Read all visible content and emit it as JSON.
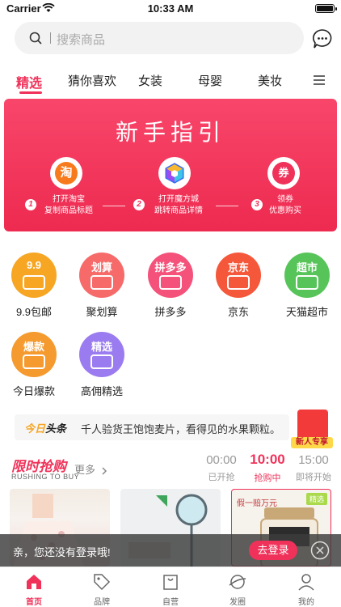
{
  "status_bar": {
    "carrier": "Carrier",
    "time": "10:33 AM"
  },
  "search": {
    "placeholder": "搜索商品"
  },
  "tabs": [
    {
      "label": "精选",
      "active": true
    },
    {
      "label": "猜你喜欢",
      "active": false
    },
    {
      "label": "女装",
      "active": false
    },
    {
      "label": "母婴",
      "active": false
    },
    {
      "label": "美妆",
      "active": false
    }
  ],
  "banner": {
    "title": "新手指引",
    "steps": [
      {
        "num": "1",
        "icon": "taobao-icon",
        "glyph": "淘",
        "line1": "打开淘宝",
        "line2": "复制商品标题"
      },
      {
        "num": "2",
        "icon": "cube-icon",
        "glyph": "",
        "line1": "打开魔方城",
        "line2": "跳转商品详情"
      },
      {
        "num": "3",
        "icon": "coupon-icon",
        "glyph": "券",
        "line1": "领券",
        "line2": "优惠购买"
      }
    ]
  },
  "grid": [
    {
      "label": "9.9包邮",
      "glyph": "9.9",
      "color": "#f6a623",
      "icon": "calendar-icon"
    },
    {
      "label": "聚划算",
      "glyph": "划算",
      "color": "#f66a6a",
      "icon": "shopping-bag-icon"
    },
    {
      "label": "拼多多",
      "glyph": "拼多多",
      "color": "#f4527a",
      "icon": "pinduoduo-icon"
    },
    {
      "label": "京东",
      "glyph": "京东",
      "color": "#f5573b",
      "icon": "jd-dog-icon"
    },
    {
      "label": "天猫超市",
      "glyph": "超市",
      "color": "#57c45a",
      "icon": "tmall-icon"
    },
    {
      "label": "今日爆款",
      "glyph": "爆款",
      "color": "#f59a2e",
      "icon": "fire-crowd-icon"
    },
    {
      "label": "高佣精选",
      "glyph": "精选",
      "color": "#9b7cf0",
      "icon": "selection-icon"
    }
  ],
  "news": {
    "logo_prefix": "今日",
    "logo_suffix": "头条",
    "text": "千人验货王饱饱麦片，看得见的水果颗粒。"
  },
  "redpacket": {
    "label": "新人专享"
  },
  "flash_sale": {
    "title": "限时抢购",
    "subtitle": "RUSHING TO BUY",
    "more": "更多",
    "slots": [
      {
        "time": "00:00",
        "status": "已开抢",
        "active": false
      },
      {
        "time": "10:00",
        "status": "抢购中",
        "active": true
      },
      {
        "time": "15:00",
        "status": "即将开始",
        "active": false
      }
    ],
    "products": [
      {
        "name": "product-dress"
      },
      {
        "name": "product-fan"
      },
      {
        "name": "product-jar",
        "label": "假一赔万元",
        "tag": "精选"
      }
    ]
  },
  "login_toast": {
    "text": "亲，您还没有登录哦!",
    "button": "去登录"
  },
  "bottom_nav": [
    {
      "label": "首页",
      "icon": "home-icon",
      "active": true
    },
    {
      "label": "品牌",
      "icon": "tag-icon",
      "active": false
    },
    {
      "label": "自营",
      "icon": "bag-icon",
      "active": false
    },
    {
      "label": "发圈",
      "icon": "planet-icon",
      "active": false
    },
    {
      "label": "我的",
      "icon": "user-icon",
      "active": false
    }
  ],
  "colors": {
    "accent": "#f0325a",
    "banner": "#ee2a50"
  }
}
